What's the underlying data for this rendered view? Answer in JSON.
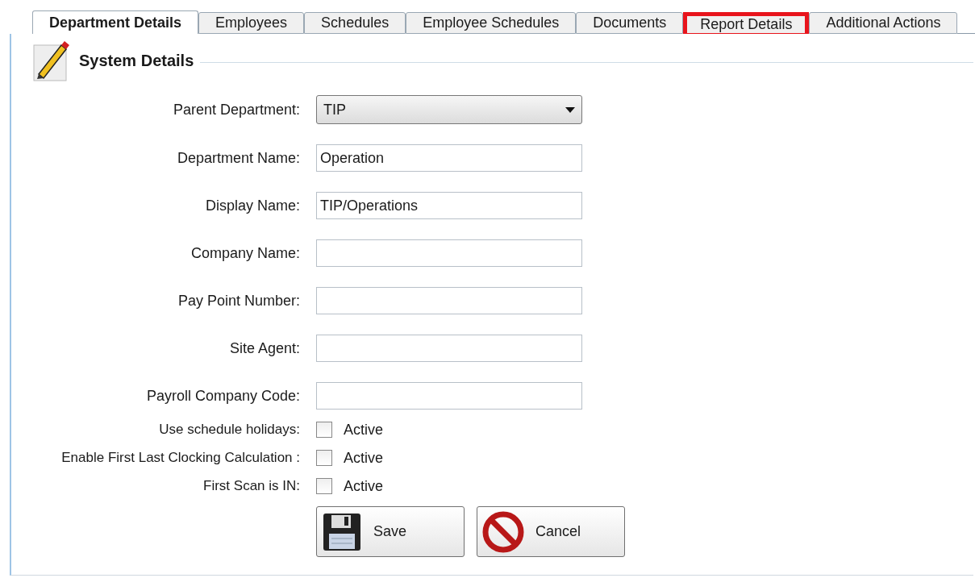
{
  "tabs": [
    {
      "label": "Department Details",
      "selected": true,
      "highlighted": false
    },
    {
      "label": "Employees",
      "selected": false,
      "highlighted": false
    },
    {
      "label": "Schedules",
      "selected": false,
      "highlighted": false
    },
    {
      "label": "Employee Schedules",
      "selected": false,
      "highlighted": false
    },
    {
      "label": "Documents",
      "selected": false,
      "highlighted": false
    },
    {
      "label": "Report Details",
      "selected": false,
      "highlighted": true
    },
    {
      "label": "Additional Actions",
      "selected": false,
      "highlighted": false
    }
  ],
  "group": {
    "title": "System Details"
  },
  "fields": [
    {
      "kind": "dropdown",
      "label": "Parent Department:",
      "value": "TIP"
    },
    {
      "kind": "text",
      "label": "Department Name:",
      "value": "Operation"
    },
    {
      "kind": "text",
      "label": "Display Name:",
      "value": "TIP/Operations"
    },
    {
      "kind": "text",
      "label": "Company Name:"
    },
    {
      "kind": "text",
      "label": "Pay Point Number:"
    },
    {
      "kind": "text",
      "label": "Site Agent:"
    },
    {
      "kind": "text",
      "label": "Payroll Company Code:"
    }
  ],
  "checks": [
    {
      "label": "Use schedule holidays:",
      "text": "Active",
      "checked": false
    },
    {
      "label": "Enable First Last Clocking Calculation :",
      "text": "Active",
      "checked": false
    },
    {
      "label": "First Scan is IN:",
      "text": "Active",
      "checked": false
    }
  ],
  "buttons": [
    {
      "kind": "save",
      "label": "Save"
    },
    {
      "kind": "cancel",
      "label": "Cancel"
    }
  ]
}
